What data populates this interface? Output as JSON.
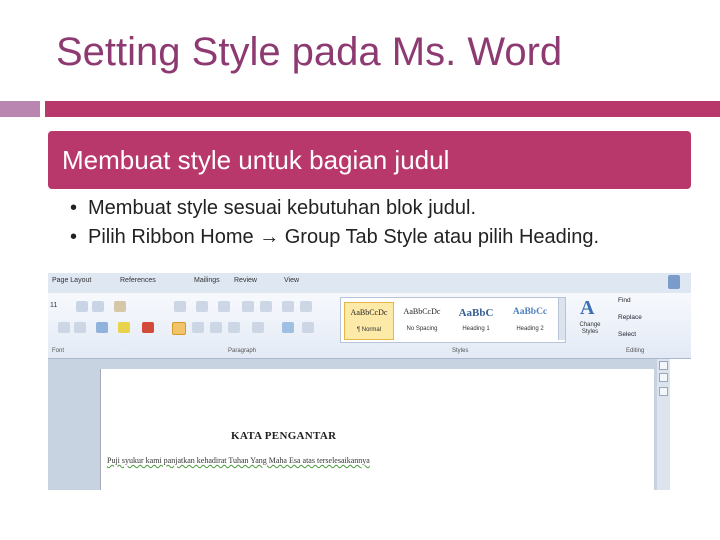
{
  "slide": {
    "title": "Setting Style pada Ms. Word",
    "subtitle": "Membuat style untuk bagian judul",
    "bullets": [
      "Membuat style sesuai kebutuhan blok judul.",
      "Pilih Ribbon Home → Group Tab Style atau pilih Heading."
    ],
    "bullet_glyph": "•",
    "colors": {
      "title": "#8e3a72",
      "bar": "#b8386b",
      "accent": "#b986b2"
    }
  },
  "word": {
    "tabs": [
      "Page Layout",
      "References",
      "Mailings",
      "Review",
      "View"
    ],
    "font_size": "11",
    "groups": [
      "Font",
      "Paragraph",
      "Styles",
      "Editing"
    ],
    "styles": [
      {
        "preview": "AaBbCcDc",
        "name": "¶ Normal"
      },
      {
        "preview": "AaBbCcDc",
        "name": "No Spacing"
      },
      {
        "preview": "AaBbC",
        "name": "Heading 1"
      },
      {
        "preview": "AaBbCc",
        "name": "Heading 2"
      }
    ],
    "change_styles": "Change Styles",
    "editing": [
      "Find",
      "Replace",
      "Select"
    ],
    "doc_heading": "KATA PENGANTAR",
    "doc_paragraph": "Puji syukur kami panjatkan kehadirat Tuhan Yang Maha Esa atas terselesaikannya"
  }
}
